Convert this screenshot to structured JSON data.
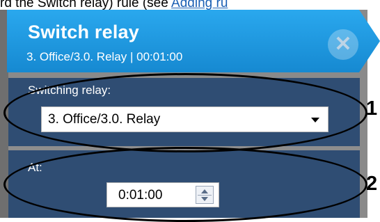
{
  "intro": {
    "text": "rd the Switch relay) rule (see ",
    "link": "Adding ru"
  },
  "dialog": {
    "title": "Switch relay",
    "subtitle": "3. Office/3.0. Relay | 00:01:00",
    "close_icon": "close-icon",
    "accent_color": "#1e9be0",
    "section_color": "#2f4d73"
  },
  "relay_section": {
    "label": "Switching relay:",
    "selected": "3. Office/3.0. Relay",
    "marker": "1"
  },
  "time_section": {
    "label": "At:",
    "value": "0:01:00",
    "marker": "2"
  }
}
